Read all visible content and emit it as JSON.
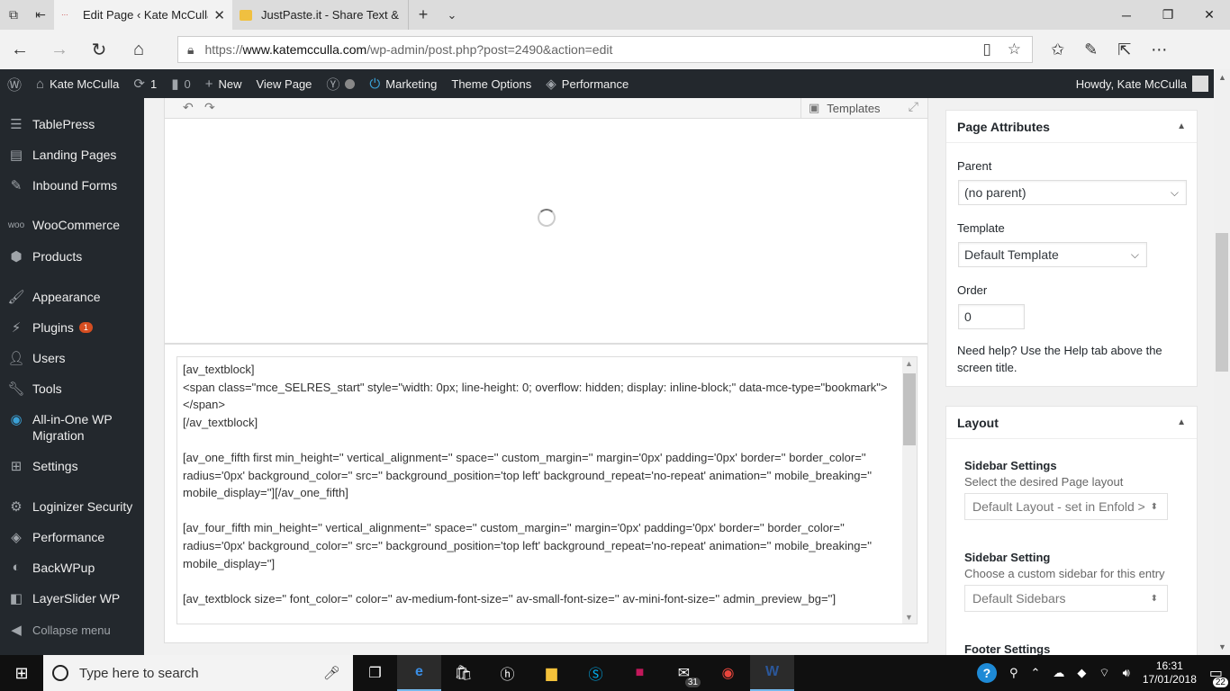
{
  "browser": {
    "tabs": [
      {
        "title": "Edit Page ‹ Kate McCulla",
        "active": true
      },
      {
        "title": "JustPaste.it - Share Text & Ir",
        "active": false
      }
    ],
    "url_prefix": "https://",
    "url_host": "www.katemcculla.com",
    "url_path": "/wp-admin/post.php?post=2490&action=edit"
  },
  "adminbar": {
    "site": "Kate McCulla",
    "updates": "1",
    "comments": "0",
    "new": "New",
    "view_page": "View Page",
    "marketing": "Marketing",
    "theme_options": "Theme Options",
    "performance": "Performance",
    "howdy": "Howdy, Kate McCulla"
  },
  "sidebar": {
    "items": [
      {
        "label": "TablePress"
      },
      {
        "label": "Landing Pages"
      },
      {
        "label": "Inbound Forms"
      },
      {
        "label": "WooCommerce"
      },
      {
        "label": "Products"
      },
      {
        "label": "Appearance"
      },
      {
        "label": "Plugins",
        "badge": "1"
      },
      {
        "label": "Users"
      },
      {
        "label": "Tools"
      },
      {
        "label": "All-in-One WP Migration"
      },
      {
        "label": "Settings"
      },
      {
        "label": "Loginizer Security"
      },
      {
        "label": "Performance"
      },
      {
        "label": "BackWPup"
      },
      {
        "label": "LayerSlider WP"
      }
    ],
    "collapse": "Collapse menu"
  },
  "editor": {
    "templates_label": "Templates",
    "text_content": "[av_textblock]\n<span class=\"mce_SELRES_start\" style=\"width: 0px; line-height: 0; overflow: hidden; display: inline-block;\" data-mce-type=\"bookmark\"></span>\n[/av_textblock]\n\n[av_one_fifth first min_height='' vertical_alignment='' space='' custom_margin='' margin='0px' padding='0px' border='' border_color='' radius='0px' background_color='' src='' background_position='top left' background_repeat='no-repeat' animation='' mobile_breaking='' mobile_display=''][/av_one_fifth]\n\n[av_four_fifth min_height='' vertical_alignment='' space='' custom_margin='' margin='0px' padding='0px' border='' border_color='' radius='0px' background_color='' src='' background_position='top left' background_repeat='no-repeat' animation='' mobile_breaking='' mobile_display='']\n\n[av_textblock size='' font_color='' color='' av-medium-font-size='' av-small-font-size='' av-mini-font-size='' admin_preview_bg='']"
  },
  "page_attributes": {
    "title": "Page Attributes",
    "parent_label": "Parent",
    "parent_value": "(no parent)",
    "template_label": "Template",
    "template_value": "Default Template",
    "order_label": "Order",
    "order_value": "0",
    "help": "Need help? Use the Help tab above the screen title."
  },
  "layout": {
    "title": "Layout",
    "sidebar_settings_title": "Sidebar Settings",
    "sidebar_settings_desc": "Select the desired Page layout",
    "sidebar_settings_value": "Default Layout - set in Enfold >",
    "sidebar_setting_title": "Sidebar Setting",
    "sidebar_setting_desc": "Choose a custom sidebar for this entry",
    "sidebar_setting_value": "Default Sidebars",
    "footer_settings_title": "Footer Settings"
  },
  "taskbar": {
    "search_placeholder": "Type here to search",
    "mail_count": "31",
    "time": "16:31",
    "date": "17/01/2018",
    "notifications": "22"
  },
  "colors": {
    "wp_dark": "#23282d",
    "badge": "#d54e21",
    "accent": "#0073aa"
  }
}
